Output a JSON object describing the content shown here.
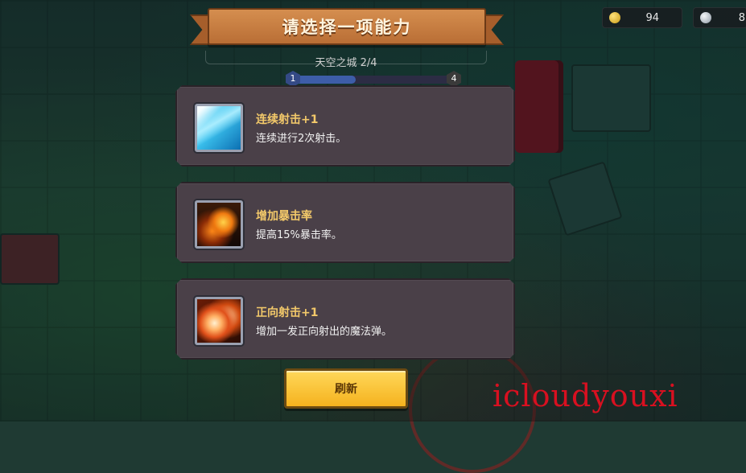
{
  "header": {
    "title": "请选择一项能力"
  },
  "stage": {
    "name": "天空之城 2/4",
    "start_node": "1",
    "end_node": "4",
    "progress": 0.4
  },
  "currency": [
    {
      "icon": "gold-coin-icon",
      "amount": "94"
    },
    {
      "icon": "silver-gem-icon",
      "amount": "8"
    }
  ],
  "abilities": [
    {
      "icon": "multishot-icon",
      "title": "连续射击+1",
      "desc": "连续进行2次射击。"
    },
    {
      "icon": "crit-rate-icon",
      "title": "增加暴击率",
      "desc": "提高15%暴击率。"
    },
    {
      "icon": "front-shot-icon",
      "title": "正向射击+1",
      "desc": "增加一发正向射出的魔法弹。"
    }
  ],
  "refresh_label": "刷新",
  "watermark": "icloudyouxi",
  "colors": {
    "card_bg": "#4a4048",
    "title_gold": "#f3c96a",
    "button_yellow": "#f5b21e",
    "banner_orange": "#c77b3f"
  }
}
